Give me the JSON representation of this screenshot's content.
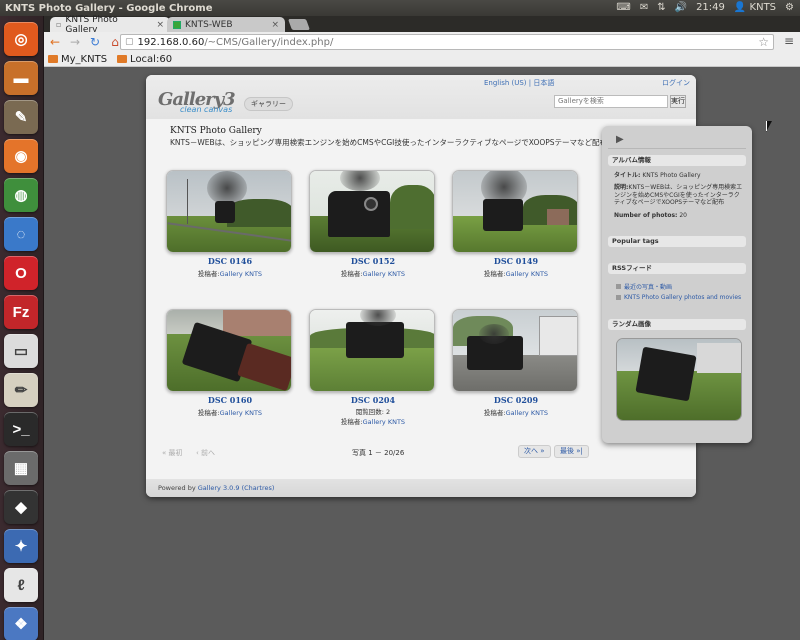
{
  "topbar": {
    "window_title": "KNTS Photo Gallery - Google Chrome",
    "indicators": [
      "⌨",
      "✉",
      "⇅",
      "🔊"
    ],
    "time": "21:49",
    "user": "KNTS",
    "gear": "⚙"
  },
  "launcher": {
    "items": [
      {
        "name": "ubuntu-dash",
        "glyph": "◎",
        "bg": "#e05a1e"
      },
      {
        "name": "files",
        "glyph": "▬",
        "bg": "#c8702a"
      },
      {
        "name": "gimp",
        "glyph": "✎",
        "bg": "#7a6a52"
      },
      {
        "name": "firefox",
        "glyph": "◉",
        "bg": "#e4742a"
      },
      {
        "name": "chrome",
        "glyph": "◍",
        "bg": "#3f8f3c"
      },
      {
        "name": "chromium",
        "glyph": "◌",
        "bg": "#3a79c9"
      },
      {
        "name": "opera",
        "glyph": "O",
        "bg": "#d0232a"
      },
      {
        "name": "filezilla",
        "glyph": "Fz",
        "bg": "#c2262a"
      },
      {
        "name": "libreoffice",
        "glyph": "▭",
        "bg": "#dcdcdc"
      },
      {
        "name": "text-editor",
        "glyph": "✏",
        "bg": "#d6d0c0"
      },
      {
        "name": "terminal",
        "glyph": ">_",
        "bg": "#2a2a2a"
      },
      {
        "name": "calculator",
        "glyph": "▦",
        "bg": "#6b6b6b"
      },
      {
        "name": "inkscape",
        "glyph": "◆",
        "bg": "#333333"
      },
      {
        "name": "thunderbird",
        "glyph": "✦",
        "bg": "#3c6ab2"
      },
      {
        "name": "libreoffice-writer",
        "glyph": "ℓ",
        "bg": "#e6e6e6"
      },
      {
        "name": "software-center",
        "glyph": "❖",
        "bg": "#4b78c2"
      }
    ]
  },
  "browser": {
    "tabs": [
      {
        "label": "KNTS Photo Gallery",
        "active": true
      },
      {
        "label": "KNTS-WEB",
        "active": false
      }
    ],
    "tab_close": "×",
    "url_host": "192.168.0.60",
    "url_path": "/~CMS/Gallery/index.php/",
    "bookmarks": [
      "My_KNTS",
      "Local:60"
    ],
    "nav": {
      "back": "←",
      "forward": "→",
      "reload": "↻",
      "home": "⌂",
      "star": "☆",
      "menu": "≡"
    }
  },
  "gallery": {
    "logo": "Gallery3",
    "logo_sub": "clean canvas",
    "breadcrumb": "ギャラリー",
    "languages": "English (US) | 日本語",
    "login": "ログイン",
    "search_placeholder": "Galleryを検索",
    "search_button": "実行",
    "title": "KNTS Photo Gallery",
    "description": "KNTS－WEBは、ショッピング専用検索エンジンを始めCMSやCGI技使ったインターラクティブなページでXOOPSテーマなど配布",
    "owner_label": "投稿者:",
    "items": [
      {
        "title": "DSC 0146",
        "owner": "Gallery KNTS",
        "extra": ""
      },
      {
        "title": "DSC 0152",
        "owner": "Gallery KNTS",
        "extra": ""
      },
      {
        "title": "DSC 0149",
        "owner": "Gallery KNTS",
        "extra": ""
      },
      {
        "title": "DSC 0160",
        "owner": "Gallery KNTS",
        "extra": ""
      },
      {
        "title": "DSC 0204",
        "owner": "Gallery KNTS",
        "extra": "閲覧回数: 2"
      },
      {
        "title": "DSC 0209",
        "owner": "Gallery KNTS",
        "extra": ""
      }
    ],
    "pager": {
      "first": "« 最初",
      "prev": "‹ 前へ",
      "count": "写真 1 － 20/26",
      "next": "次へ »",
      "last": "最後 »|"
    },
    "footer_prefix": "Powered by ",
    "footer_link": "Gallery 3.0.9 (Chartres)"
  },
  "sidebar": {
    "play": "▶",
    "album_info_header": "アルバム情報",
    "title_label": "タイトル:",
    "title_value": "KNTS Photo Gallery",
    "desc_label": "説明:",
    "desc_value": "KNTS－WEBは、ショッピング専用検索エンジンを始めCMSやCGIを使ったインターラクティブなページでXOOPSテーマなど配布",
    "photos_label": "Number of photos:",
    "photos_value": "20",
    "popular_tags_header": "Popular tags",
    "rss_header": "RSSフィード",
    "rss_items": [
      "最近の写真・動画",
      "KNTS Photo Gallery photos and movies"
    ],
    "random_header": "ランダム画像"
  }
}
